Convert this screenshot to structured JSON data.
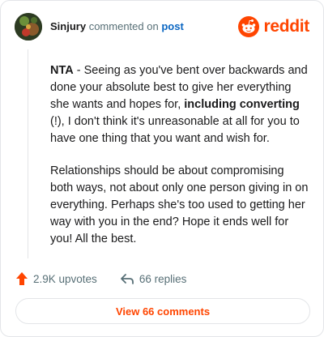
{
  "header": {
    "username": "Sinjury",
    "commented_text": "commented on",
    "post_link": "post",
    "logo_text": "reddit"
  },
  "comment": {
    "p1_lead": "NTA",
    "p1_a": " - Seeing as you've bent over backwards and done your absolute best to give her everything she wants and hopes for, ",
    "p1_bold": "including converting",
    "p1_b": " (!), I don't think it's unreasonable at all for you to have one thing that you want and wish for.",
    "p2": "Relationships should be about compromising both ways, not about only one person giving in on everything. Perhaps she's too used to getting her way with you in the end? Hope it ends well for you! All the best."
  },
  "actions": {
    "upvotes": "2.9K upvotes",
    "replies": "66 replies"
  },
  "view_button": "View 66 comments",
  "colors": {
    "accent": "#ff4500",
    "link": "#0a66c2",
    "muted": "#576f76",
    "border": "#e3e5e8"
  },
  "icons": {
    "logo": "reddit-snoo-icon",
    "upvote": "upvote-arrow-icon",
    "reply": "reply-arrow-icon"
  }
}
